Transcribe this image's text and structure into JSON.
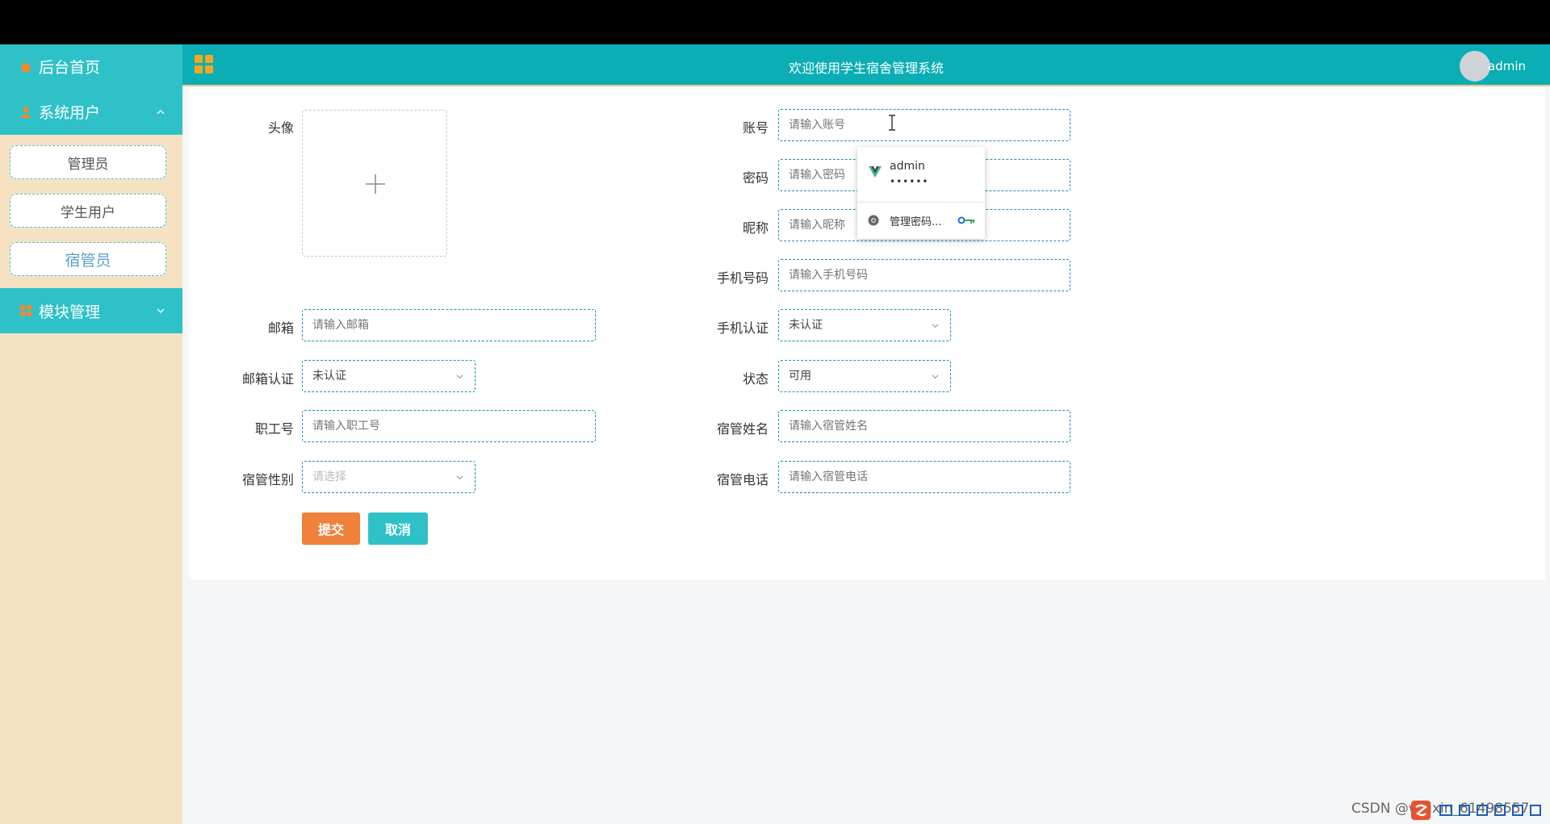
{
  "sidebar": {
    "home": "后台首页",
    "system_users": "系统用户",
    "admin_item": "管理员",
    "student_item": "学生用户",
    "dorm_manager_item": "宿管员",
    "module_mgmt": "模块管理"
  },
  "header": {
    "title": "欢迎使用学生宿舍管理系统",
    "username": "admin"
  },
  "form": {
    "avatar_label": "头像",
    "account_label": "账号",
    "account_placeholder": "请输入账号",
    "password_label": "密码",
    "password_placeholder": "请输入密码",
    "nickname_label": "昵称",
    "nickname_placeholder": "请输入昵称",
    "phone_label": "手机号码",
    "phone_placeholder": "请输入手机号码",
    "email_label": "邮箱",
    "email_placeholder": "请输入邮箱",
    "phone_verify_label": "手机认证",
    "phone_verify_value": "未认证",
    "email_verify_label": "邮箱认证",
    "email_verify_value": "未认证",
    "status_label": "状态",
    "status_value": "可用",
    "staff_id_label": "职工号",
    "staff_id_placeholder": "请输入职工号",
    "manager_name_label": "宿管姓名",
    "manager_name_placeholder": "请输入宿管姓名",
    "manager_gender_label": "宿管性别",
    "manager_gender_placeholder": "请选择",
    "manager_phone_label": "宿管电话",
    "manager_phone_placeholder": "请输入宿管电话",
    "submit_label": "提交",
    "cancel_label": "取消"
  },
  "autofill": {
    "username": "admin",
    "password_mask": "••••••",
    "manage": "管理密码..."
  },
  "watermark": "CSDN @weixin_61498557",
  "colors": {
    "sidebar_bg": "#f5e2c3",
    "menu_teal": "#2fc1c8",
    "header_teal": "#0aaeb4",
    "submit": "#f0813a",
    "cancel": "#2fc1c8"
  }
}
